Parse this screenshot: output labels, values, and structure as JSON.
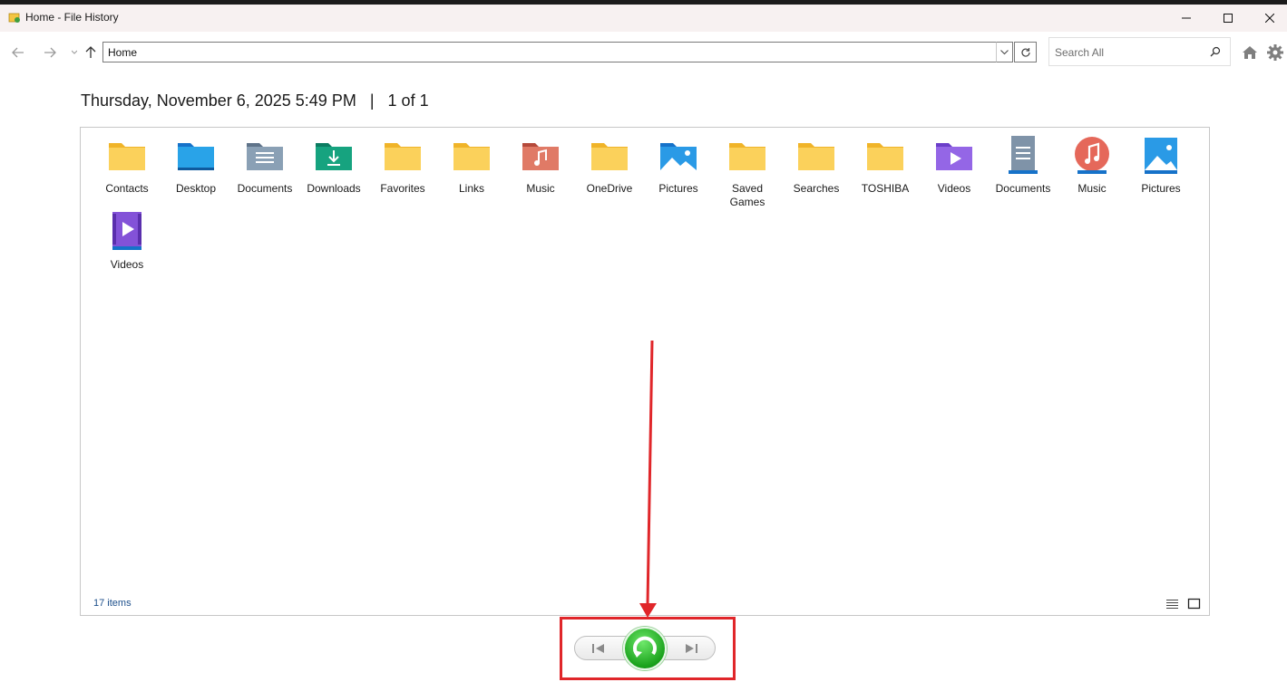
{
  "window": {
    "title": "Home - File History",
    "minimize_icon": "minimize-icon",
    "maximize_icon": "maximize-icon",
    "close_icon": "close-icon"
  },
  "toolbar": {
    "address": "Home",
    "search_placeholder": "Search All"
  },
  "header": {
    "date": "Thursday, November 6, 2025 5:49 PM",
    "separator": "|",
    "page": "1 of 1"
  },
  "items": [
    {
      "label": "Contacts",
      "icon": "folder-icon"
    },
    {
      "label": "Desktop",
      "icon": "desktop-folder-icon"
    },
    {
      "label": "Documents",
      "icon": "documents-folder-icon"
    },
    {
      "label": "Downloads",
      "icon": "downloads-folder-icon"
    },
    {
      "label": "Favorites",
      "icon": "folder-icon"
    },
    {
      "label": "Links",
      "icon": "folder-icon"
    },
    {
      "label": "Music",
      "icon": "music-folder-icon"
    },
    {
      "label": "OneDrive",
      "icon": "folder-icon"
    },
    {
      "label": "Pictures",
      "icon": "pictures-folder-icon"
    },
    {
      "label": "Saved Games",
      "icon": "folder-icon"
    },
    {
      "label": "Searches",
      "icon": "folder-icon"
    },
    {
      "label": "TOSHIBA",
      "icon": "folder-icon"
    },
    {
      "label": "Videos",
      "icon": "videos-folder-icon"
    },
    {
      "label": "Documents",
      "icon": "documents-library-icon"
    },
    {
      "label": "Music",
      "icon": "music-library-icon"
    },
    {
      "label": "Pictures",
      "icon": "pictures-library-icon"
    },
    {
      "label": "Videos",
      "icon": "videos-library-icon"
    }
  ],
  "status": {
    "count": "17 items"
  },
  "colors": {
    "annotation_red": "#e0262a",
    "restore_green": "#1aa21c",
    "folder_yellow": "#f8c843"
  }
}
